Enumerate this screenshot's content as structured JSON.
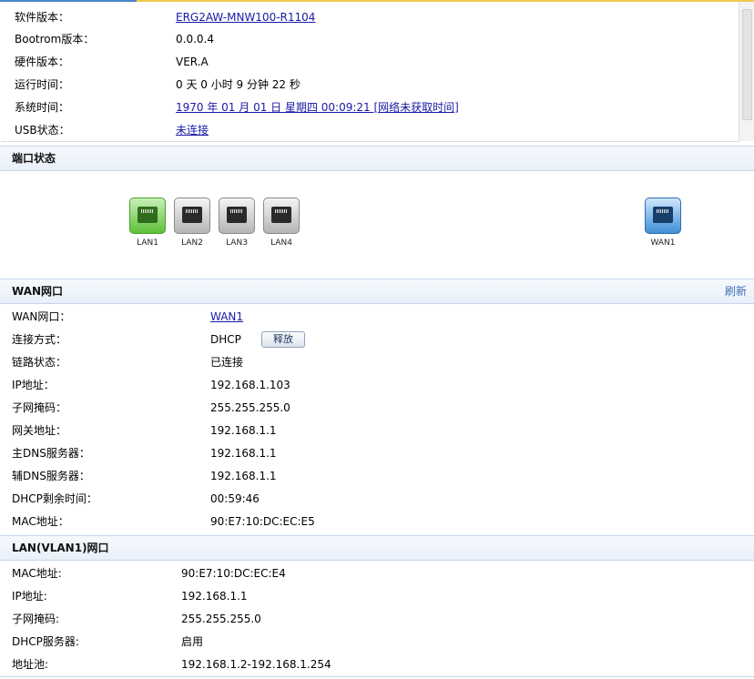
{
  "system_info": {
    "rows": [
      {
        "label": "软件版本：",
        "value": "ERG2AW-MNW100-R1104",
        "link": true
      },
      {
        "label": "Bootrom版本：",
        "value": "0.0.0.4",
        "link": false
      },
      {
        "label": "硬件版本：",
        "value": "VER.A",
        "link": false
      },
      {
        "label": "运行时间：",
        "value": "0 天 0 小时 9 分钟 22 秒",
        "link": false
      },
      {
        "label": "系统时间：",
        "value": "1970 年 01 月 01 日 星期四 00:09:21 [网络未获取时间]",
        "link": true
      },
      {
        "label": "USB状态：",
        "value": "未连接",
        "link": true
      }
    ]
  },
  "port_status": {
    "title": "端口状态",
    "ports": [
      {
        "label": "LAN1",
        "state": "connected",
        "color": "#5fbf3a",
        "icon": "ethernet-port-icon"
      },
      {
        "label": "LAN2",
        "state": "disconnected",
        "color": "#b5b5b5",
        "icon": "ethernet-port-icon"
      },
      {
        "label": "LAN3",
        "state": "disconnected",
        "color": "#b5b5b5",
        "icon": "ethernet-port-icon"
      },
      {
        "label": "LAN4",
        "state": "disconnected",
        "color": "#b5b5b5",
        "icon": "ethernet-port-icon"
      },
      {
        "label": "WAN1",
        "state": "wan",
        "color": "#3f8fd6",
        "icon": "ethernet-port-icon"
      }
    ]
  },
  "wan": {
    "title": "WAN网口",
    "refresh_label": "刷新",
    "release_label": "释放",
    "rows": [
      {
        "label": "WAN网口：",
        "value": "WAN1",
        "link": true
      },
      {
        "label": "连接方式：",
        "value": "DHCP",
        "link": false
      },
      {
        "label": "链路状态：",
        "value": "已连接",
        "link": false
      },
      {
        "label": "IP地址：",
        "value": "192.168.1.103",
        "link": false
      },
      {
        "label": "子网掩码：",
        "value": "255.255.255.0",
        "link": false
      },
      {
        "label": "网关地址：",
        "value": "192.168.1.1",
        "link": false
      },
      {
        "label": "主DNS服务器：",
        "value": "192.168.1.1",
        "link": false
      },
      {
        "label": "辅DNS服务器：",
        "value": "192.168.1.1",
        "link": false
      },
      {
        "label": "DHCP剩余时间：",
        "value": "00:59:46",
        "link": false
      },
      {
        "label": "MAC地址：",
        "value": "90:E7:10:DC:EC:E5",
        "link": false
      }
    ]
  },
  "lan": {
    "title": "LAN(VLAN1)网口",
    "rows": [
      {
        "label": "MAC地址:",
        "value": "90:E7:10:DC:EC:E4"
      },
      {
        "label": "IP地址:",
        "value": "192.168.1.1"
      },
      {
        "label": "子网掩码:",
        "value": "255.255.255.0"
      },
      {
        "label": "DHCP服务器:",
        "value": "启用"
      },
      {
        "label": "地址池:",
        "value": "192.168.1.2-192.168.1.254"
      }
    ]
  }
}
